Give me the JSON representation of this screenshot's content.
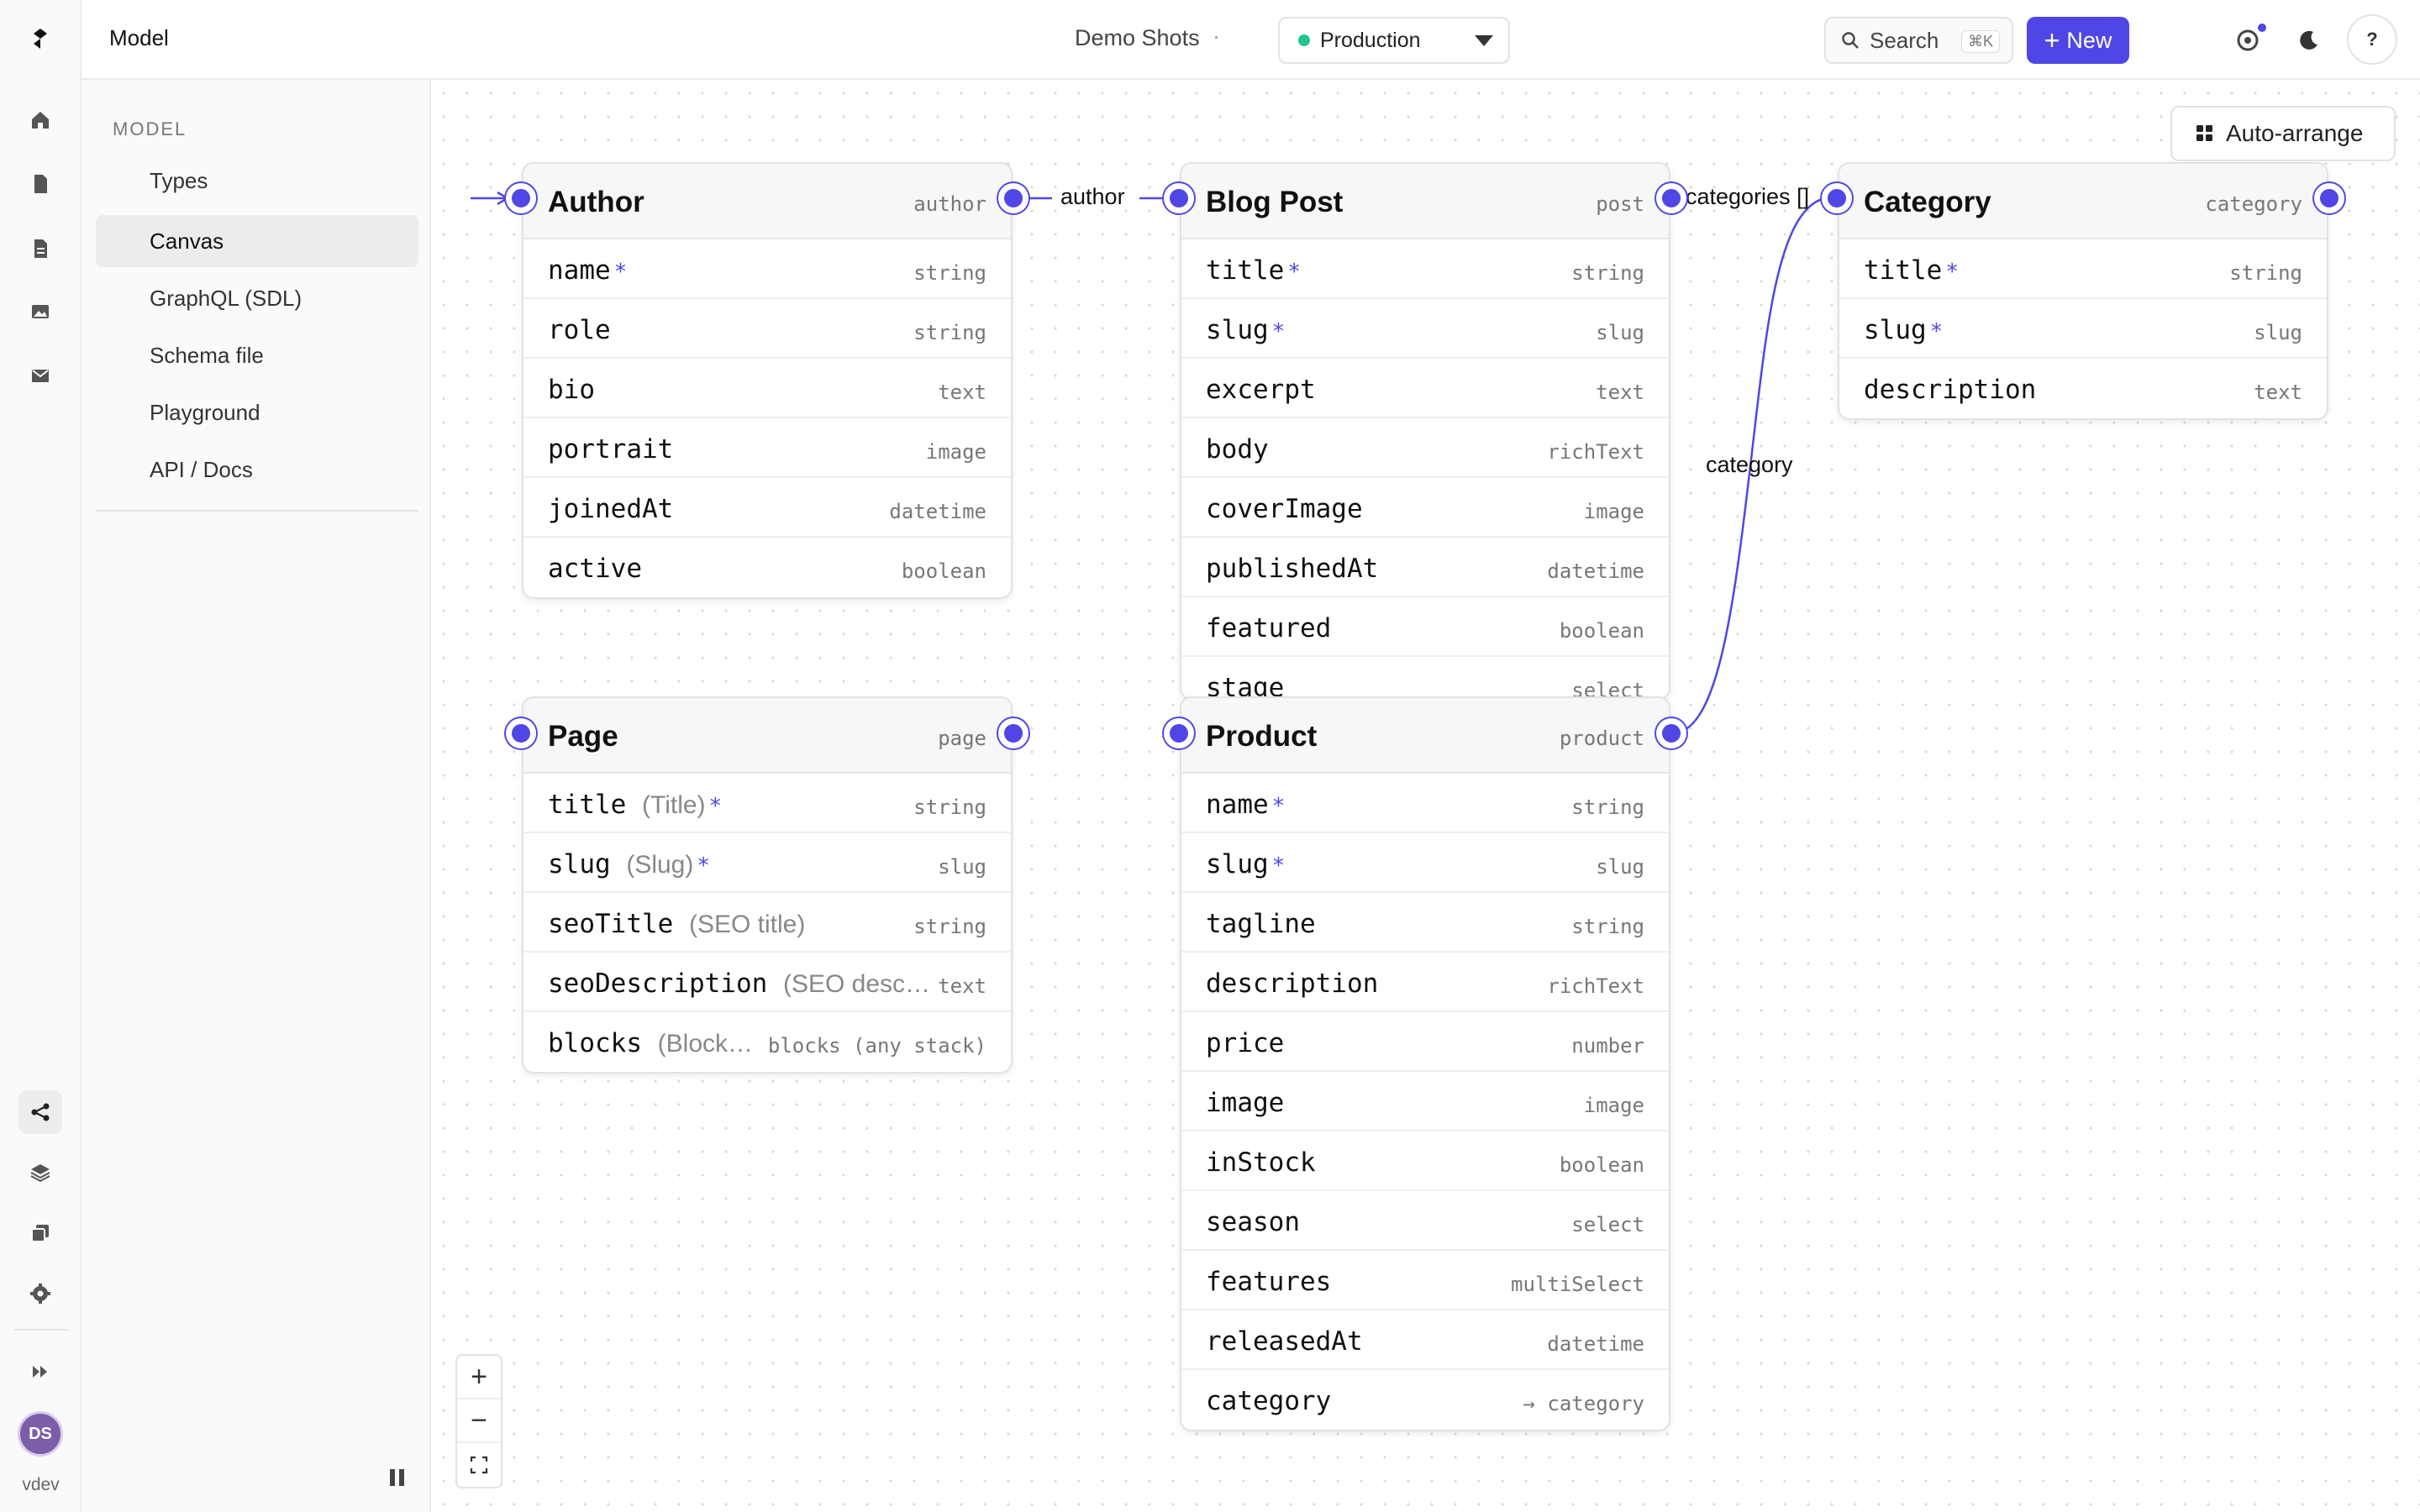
{
  "topbar": {
    "title": "Model",
    "project": "Demo Shots",
    "separator": "·",
    "environment": "Production",
    "search_label": "Search",
    "search_shortcut": "⌘K",
    "new_label": "New",
    "help_label": "?"
  },
  "rail": {
    "user_label": "vdev",
    "avatar_initials": "DS"
  },
  "sidebar": {
    "heading": "MODEL",
    "items": [
      {
        "label": "Types"
      },
      {
        "label": "Canvas"
      },
      {
        "label": "GraphQL (SDL)"
      },
      {
        "label": "Schema file"
      },
      {
        "label": "Playground"
      },
      {
        "label": "API / Docs"
      }
    ]
  },
  "canvas": {
    "auto_arrange_label": "Auto-arrange",
    "edges": {
      "author": "author",
      "categories": "categories []",
      "category": "category"
    },
    "nodes": {
      "author": {
        "title": "Author",
        "api": "author",
        "fields": [
          {
            "name": "name",
            "req": "*",
            "type": "string"
          },
          {
            "name": "role",
            "type": "string"
          },
          {
            "name": "bio",
            "type": "text"
          },
          {
            "name": "portrait",
            "type": "image"
          },
          {
            "name": "joinedAt",
            "type": "datetime"
          },
          {
            "name": "active",
            "type": "boolean"
          }
        ]
      },
      "blogpost": {
        "title": "Blog Post",
        "api": "post",
        "fields": [
          {
            "name": "title",
            "req": "*",
            "type": "string"
          },
          {
            "name": "slug",
            "req": "*",
            "type": "slug"
          },
          {
            "name": "excerpt",
            "type": "text"
          },
          {
            "name": "body",
            "type": "richText"
          },
          {
            "name": "coverImage",
            "type": "image"
          },
          {
            "name": "publishedAt",
            "type": "datetime"
          },
          {
            "name": "featured",
            "type": "boolean"
          },
          {
            "name": "stage",
            "type": "select"
          }
        ]
      },
      "category": {
        "title": "Category",
        "api": "category",
        "fields": [
          {
            "name": "title",
            "req": "*",
            "type": "string"
          },
          {
            "name": "slug",
            "req": "*",
            "type": "slug"
          },
          {
            "name": "description",
            "type": "text"
          }
        ]
      },
      "page": {
        "title": "Page",
        "api": "page",
        "fields": [
          {
            "name": "title",
            "label": "(Title)",
            "req": "*",
            "type": "string"
          },
          {
            "name": "slug",
            "label": "(Slug)",
            "req": "*",
            "type": "slug"
          },
          {
            "name": "seoTitle",
            "label": "(SEO title)",
            "type": "string"
          },
          {
            "name": "seoDescription",
            "label": "(SEO desc…",
            "type": "text"
          },
          {
            "name": "blocks",
            "label": "(Block…",
            "type": "blocks (any stack)"
          }
        ]
      },
      "product": {
        "title": "Product",
        "api": "product",
        "fields": [
          {
            "name": "name",
            "req": "*",
            "type": "string"
          },
          {
            "name": "slug",
            "req": "*",
            "type": "slug"
          },
          {
            "name": "tagline",
            "type": "string"
          },
          {
            "name": "description",
            "type": "richText"
          },
          {
            "name": "price",
            "type": "number"
          },
          {
            "name": "image",
            "type": "image"
          },
          {
            "name": "inStock",
            "type": "boolean"
          },
          {
            "name": "season",
            "type": "select"
          },
          {
            "name": "features",
            "type": "multiSelect"
          },
          {
            "name": "releasedAt",
            "type": "datetime"
          },
          {
            "name": "category",
            "type": "→ category"
          }
        ]
      }
    },
    "zoom": {
      "in": "+",
      "out": "−"
    }
  },
  "colors": {
    "accent": "#4f46e5",
    "env_status": "#22c38e",
    "avatar": "#7b5ea7"
  }
}
